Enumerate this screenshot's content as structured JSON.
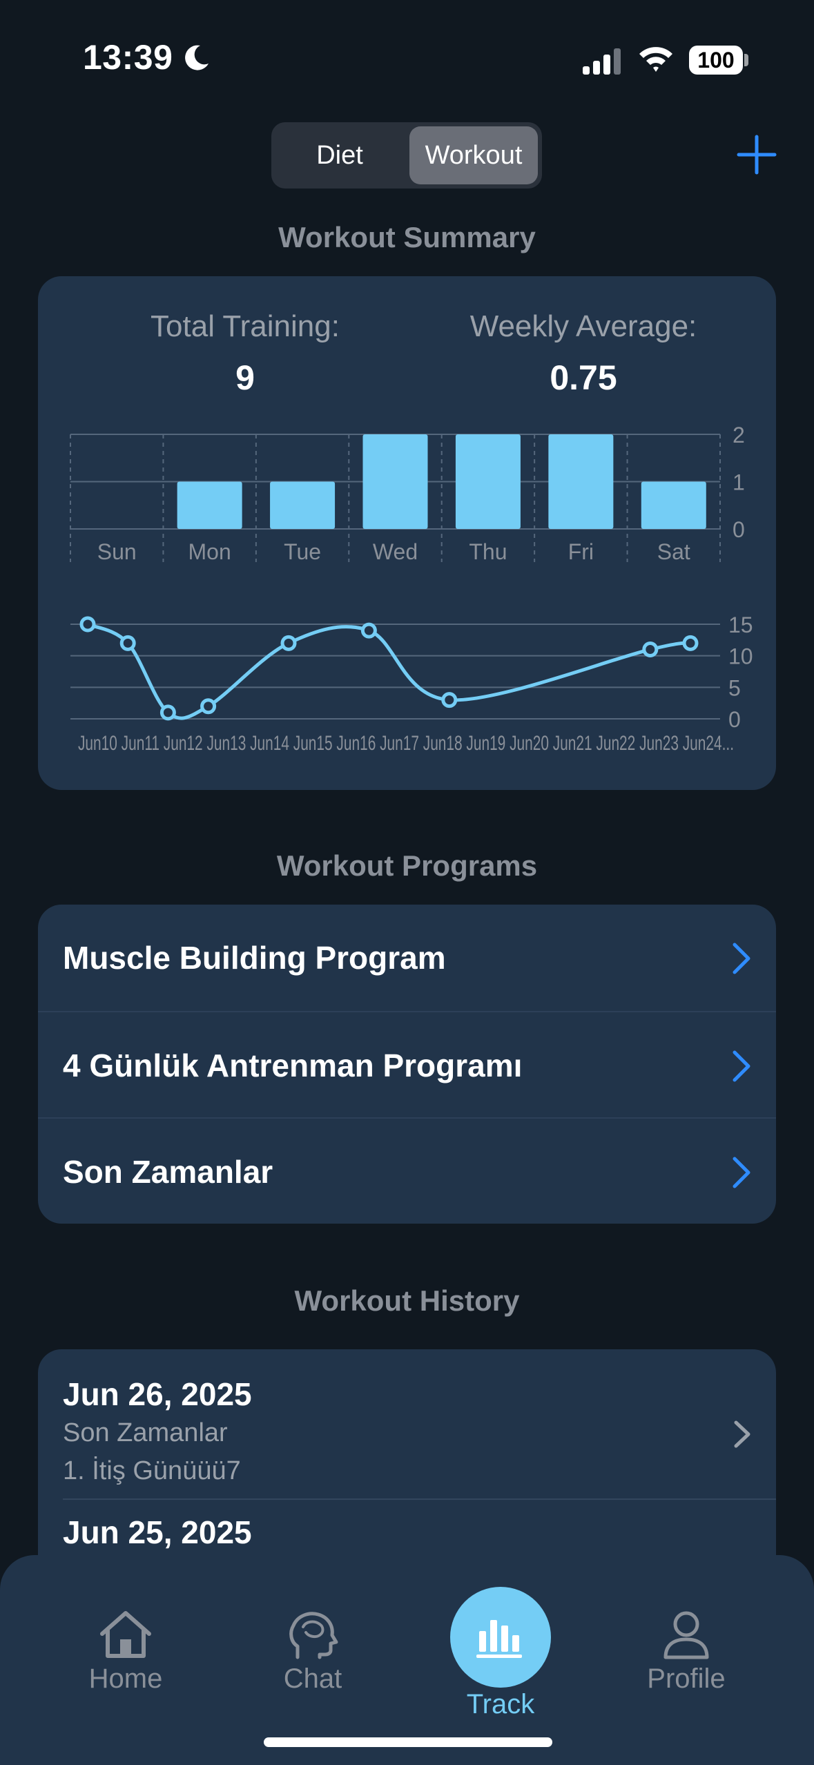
{
  "status": {
    "time": "13:39",
    "battery": "100"
  },
  "segmented": {
    "options": [
      "Diet",
      "Workout"
    ],
    "selected": "Workout"
  },
  "summary": {
    "title": "Workout Summary",
    "total_label": "Total Training:",
    "total_value": "9",
    "avg_label": "Weekly Average:",
    "avg_value": "0.75"
  },
  "chart_data": [
    {
      "type": "bar",
      "categories": [
        "Sun",
        "Mon",
        "Tue",
        "Wed",
        "Thu",
        "Fri",
        "Sat"
      ],
      "values": [
        0,
        1,
        1,
        2,
        2,
        2,
        1
      ],
      "ylim": [
        0,
        2
      ],
      "yticks": [
        0,
        1,
        2
      ],
      "grid": true,
      "color": "#74cdf5"
    },
    {
      "type": "line",
      "x": [
        "Jun 10",
        "Jun 11",
        "Jun 12",
        "Jun 13",
        "Jun 14",
        "Jun 15",
        "Jun 16",
        "Jun 17",
        "Jun 18",
        "Jun 19",
        "Jun 20",
        "Jun 21",
        "Jun 22",
        "Jun 23",
        "Jun 24"
      ],
      "x_tick_text": "Jun10 Jun11 Jun12 Jun13 Jun14 Jun15 Jun16 Jun17 Jun18 Jun19 Jun20 Jun21 Jun22 Jun23 Jun24...",
      "points": [
        {
          "x": "Jun 10",
          "y": 15
        },
        {
          "x": "Jun 11",
          "y": 12
        },
        {
          "x": "Jun 12",
          "y": 1
        },
        {
          "x": "Jun 13",
          "y": 2
        },
        {
          "x": "Jun 15",
          "y": 12
        },
        {
          "x": "Jun 17",
          "y": 14
        },
        {
          "x": "Jun 19",
          "y": 3
        },
        {
          "x": "Jun 24",
          "y": 11
        },
        {
          "x": "Jun 25",
          "y": 12
        }
      ],
      "ylim": [
        0,
        15
      ],
      "yticks": [
        0,
        5,
        10,
        15
      ],
      "grid": true,
      "color": "#74cdf5"
    }
  ],
  "programs": {
    "title": "Workout Programs",
    "items": [
      "Muscle Building Program",
      "4 Günlük Antrenman Programı",
      "Son Zamanlar"
    ]
  },
  "history": {
    "title": "Workout History",
    "items": [
      {
        "date": "Jun 26, 2025",
        "program": "Son Zamanlar",
        "day": "1. İtiş Günüüü7"
      },
      {
        "date": "Jun 25, 2025"
      }
    ]
  },
  "tabs": [
    {
      "label": "Home",
      "icon": "home-icon"
    },
    {
      "label": "Chat",
      "icon": "brain-icon"
    },
    {
      "label": "Track",
      "icon": "chart-icon",
      "active": true
    },
    {
      "label": "Profile",
      "icon": "person-icon"
    }
  ],
  "colors": {
    "accent": "#2f8cff",
    "chart": "#74cdf5",
    "background": "#101820",
    "card": "#21344a"
  }
}
